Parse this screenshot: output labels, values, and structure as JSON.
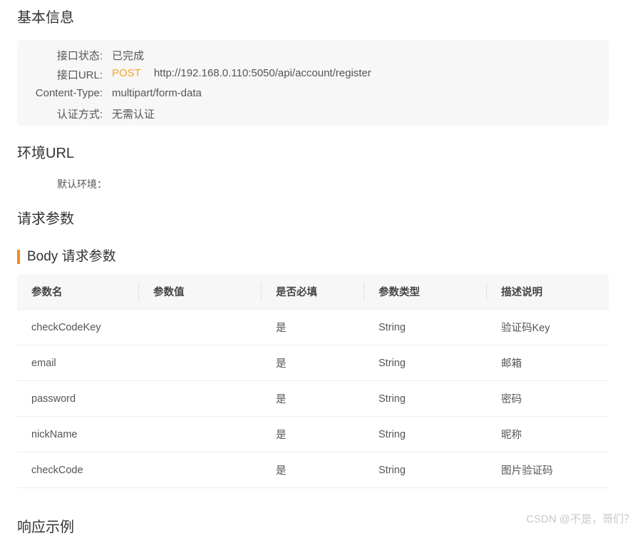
{
  "basic_info": {
    "title": "基本信息",
    "rows": [
      {
        "label": "接口状态:",
        "value": "已完成"
      },
      {
        "label": "接口URL:",
        "method": "POST",
        "value": "http://192.168.0.110:5050/api/account/register"
      },
      {
        "label": "Content-Type:",
        "value": "multipart/form-data"
      },
      {
        "label": "认证方式:",
        "value": "无需认证"
      }
    ]
  },
  "env": {
    "title": "环境URL",
    "default_label": "默认环境："
  },
  "request_params": {
    "title": "请求参数",
    "body_title": "Body 请求参数",
    "columns": [
      "参数名",
      "参数值",
      "是否必填",
      "参数类型",
      "描述说明"
    ],
    "rows": [
      {
        "name": "checkCodeKey",
        "value": "",
        "required": "是",
        "type": "String",
        "desc": "验证码Key"
      },
      {
        "name": "email",
        "value": "",
        "required": "是",
        "type": "String",
        "desc": "邮箱"
      },
      {
        "name": "password",
        "value": "",
        "required": "是",
        "type": "String",
        "desc": "密码"
      },
      {
        "name": "nickName",
        "value": "",
        "required": "是",
        "type": "String",
        "desc": "昵称"
      },
      {
        "name": "checkCode",
        "value": "",
        "required": "是",
        "type": "String",
        "desc": "图片验证码"
      }
    ]
  },
  "response": {
    "title": "响应示例"
  },
  "watermark": "CSDN @不是，哥们？",
  "colors": {
    "accent": "#f08c1e",
    "method": "#f5a623",
    "panel_bg": "#f7f7f7"
  }
}
